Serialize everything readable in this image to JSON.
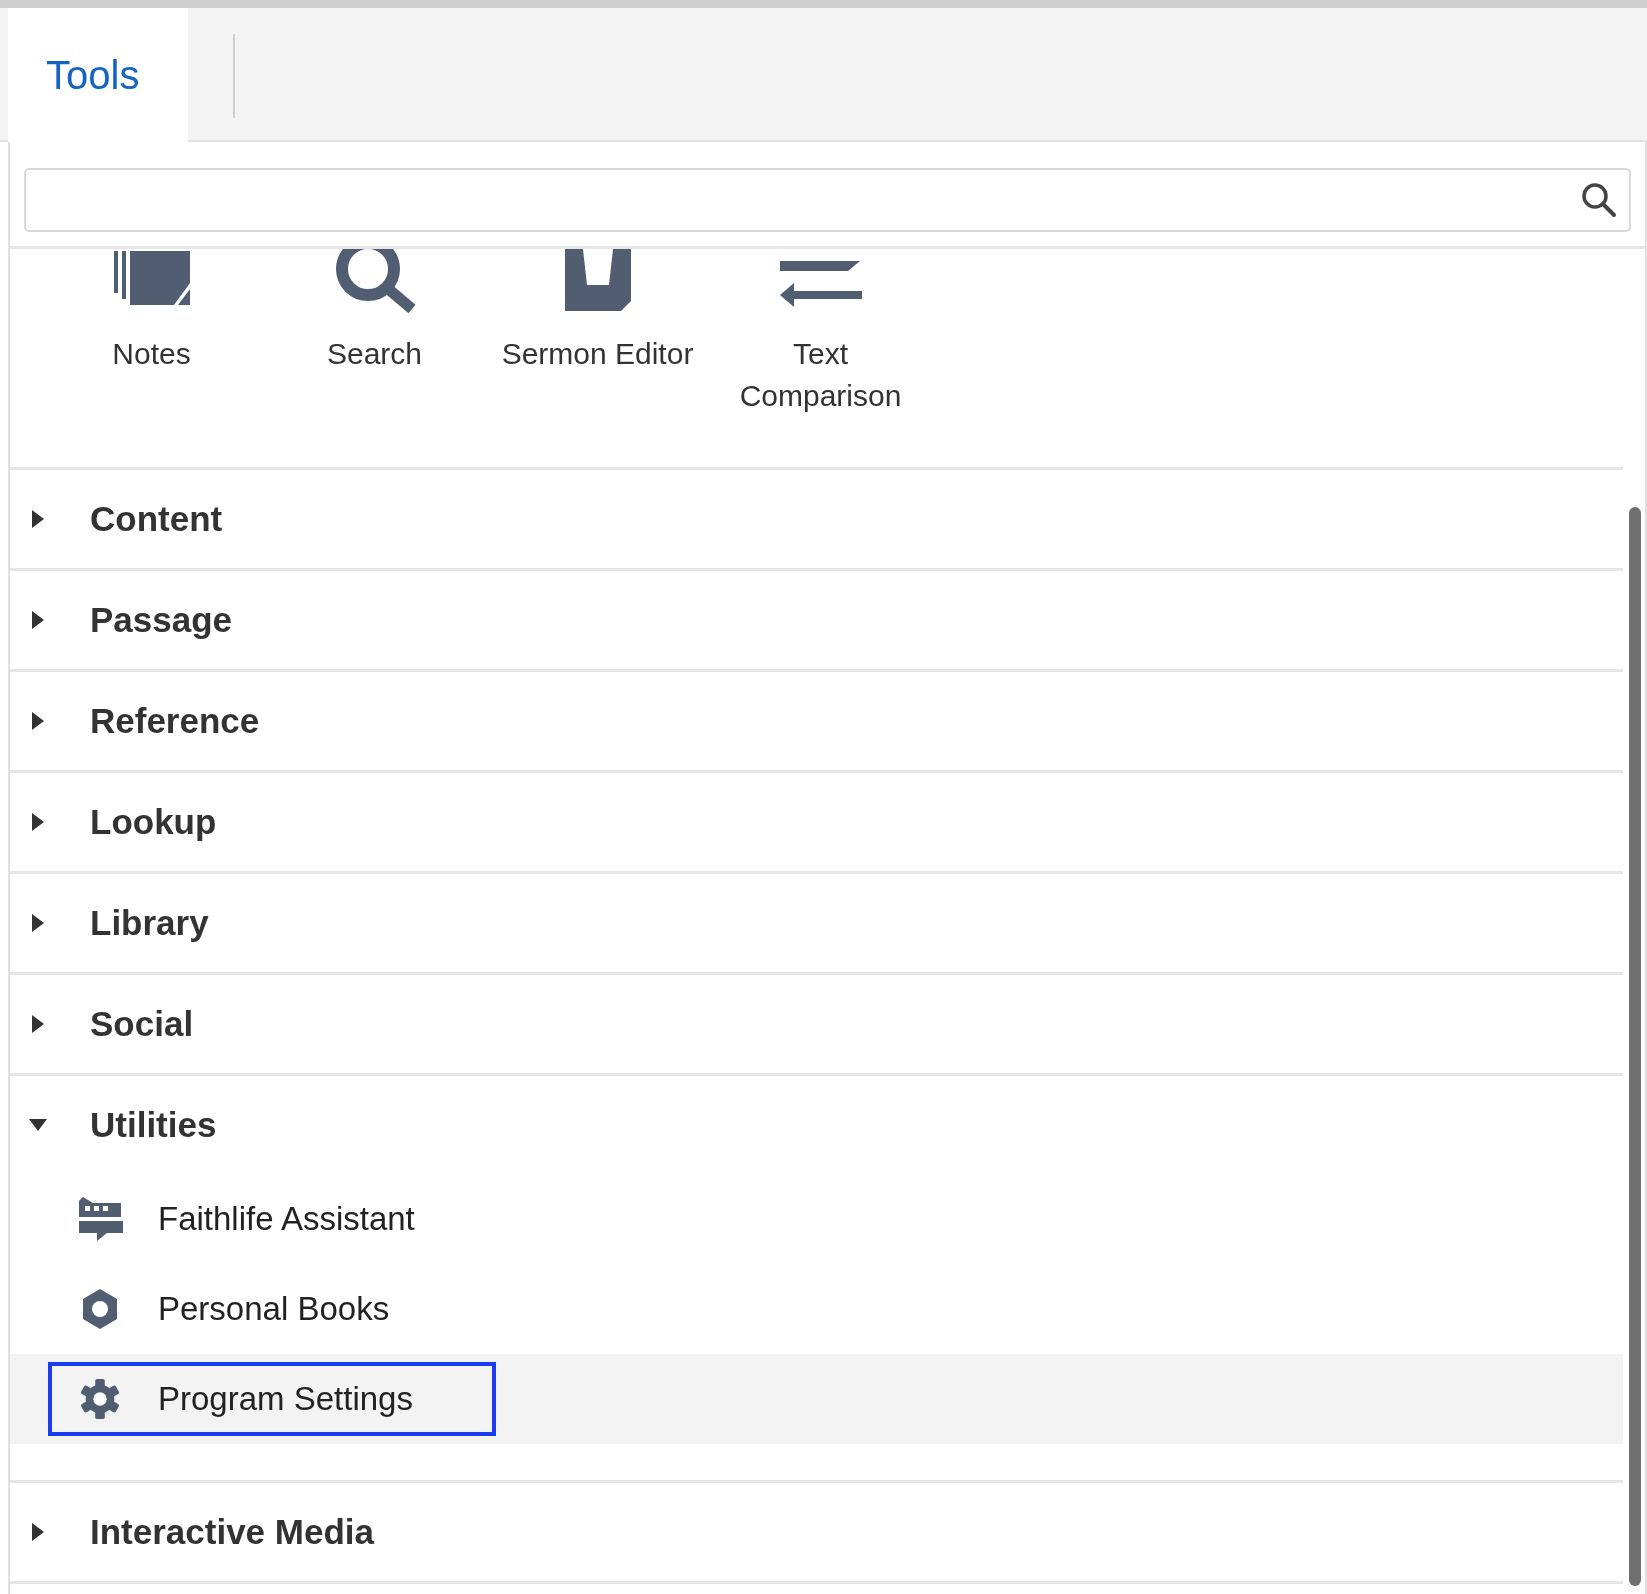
{
  "tabs": [
    {
      "label": "Tools",
      "selected": true
    }
  ],
  "tools": [
    {
      "label": "Notes",
      "kind": "notes"
    },
    {
      "label": "Search",
      "kind": "search"
    },
    {
      "label": "Sermon Editor",
      "kind": "sermon"
    },
    {
      "label": "Text Comparison",
      "kind": "compare"
    }
  ],
  "sections": [
    {
      "label": "Content",
      "expanded": false
    },
    {
      "label": "Passage",
      "expanded": false
    },
    {
      "label": "Reference",
      "expanded": false
    },
    {
      "label": "Lookup",
      "expanded": false
    },
    {
      "label": "Library",
      "expanded": false
    },
    {
      "label": "Social",
      "expanded": false
    },
    {
      "label": "Utilities",
      "expanded": true,
      "children": [
        {
          "label": "Faithlife Assistant",
          "kind": "assistant",
          "selected": false
        },
        {
          "label": "Personal Books",
          "kind": "books",
          "selected": false
        },
        {
          "label": "Program Settings",
          "kind": "settings",
          "selected": true
        }
      ]
    },
    {
      "label": "Interactive Media",
      "expanded": false
    }
  ]
}
